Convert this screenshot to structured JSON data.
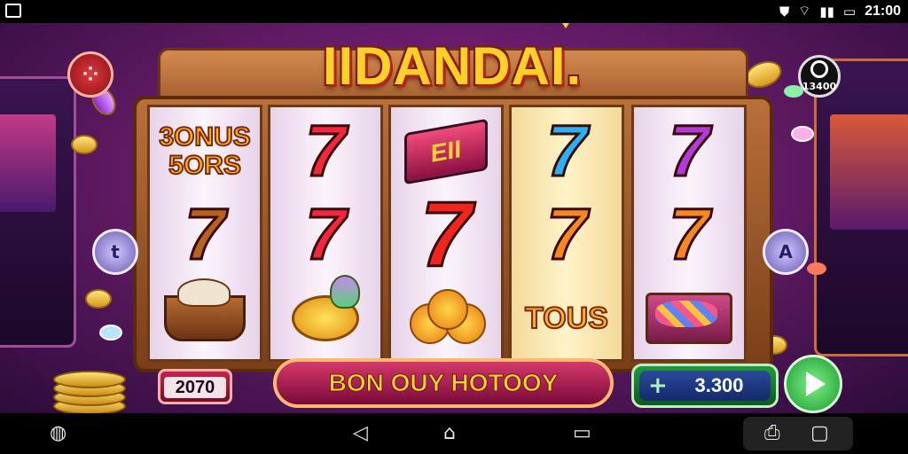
{
  "status_bar": {
    "time": "21:00",
    "icons": [
      "image-icon",
      "shield-icon",
      "wifi-icon",
      "signal-icon",
      "battery-icon"
    ]
  },
  "game": {
    "title": "IIDANDAI.",
    "coin_badge": "13400",
    "reels": [
      [
        "bonus-text",
        "seven-brown",
        "basket"
      ],
      [
        "seven-red",
        "seven-red",
        "mango-fruit"
      ],
      [
        "banner-symbol",
        "seven-red-big",
        "oranges"
      ],
      [
        "seven-blue",
        "seven-orange",
        "tous-text"
      ],
      [
        "seven-purple",
        "seven-orange",
        "gem-box"
      ]
    ],
    "reel1_bonus_text": "3ONUS\n5ORS",
    "reel3_banner_text": "EII",
    "reel4_tous_text": "TOUS",
    "balance": "2070",
    "banner_text": "BON OUY HOTOOY",
    "bet_amount": "3.300",
    "bet_plus": "+",
    "left_arrow": "t",
    "right_arrow": "A",
    "menu_icon": "grid-icon",
    "colors": {
      "seven_red": "#f5263e",
      "seven_brown": "#b4621e",
      "seven_blue": "#2ab0f5",
      "seven_orange": "#f5881e",
      "seven_purple": "#b23ad6",
      "gold": "#ffcf2a",
      "spin_green": "#3ccb4a"
    }
  },
  "nav_bar": {
    "icons": [
      "assistant-icon",
      "back-icon",
      "home-icon",
      "recents-icon",
      "screenshot-icon",
      "square-icon"
    ]
  }
}
